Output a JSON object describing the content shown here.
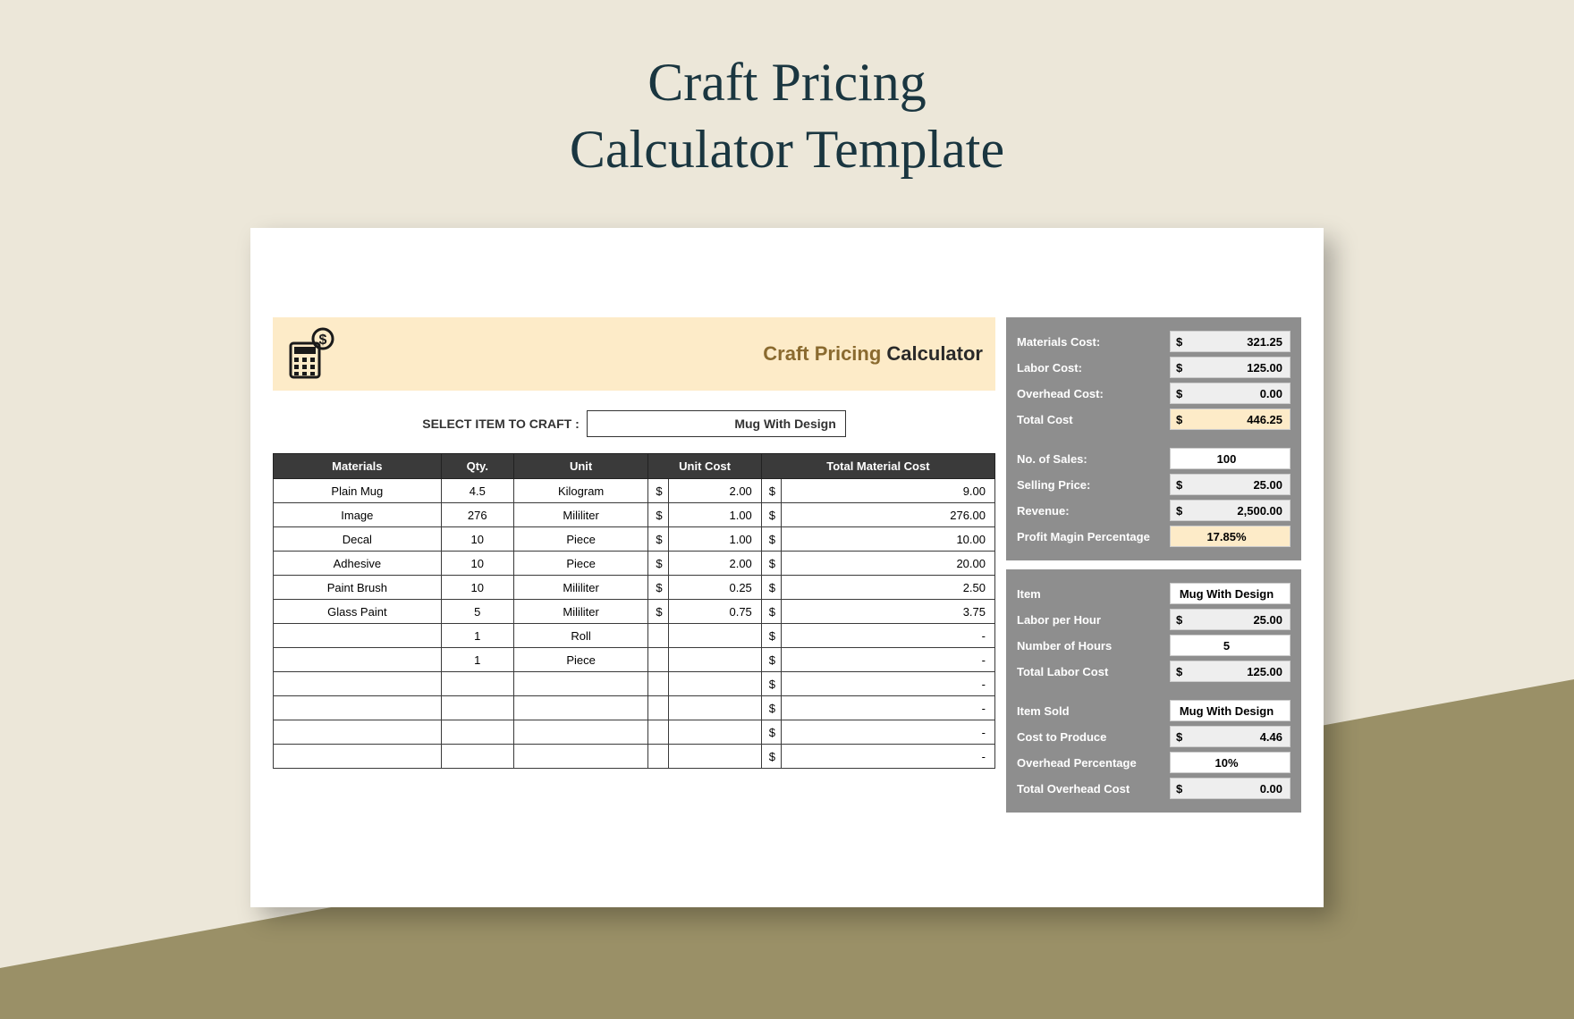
{
  "title_l1": "Craft Pricing",
  "title_l2": "Calculator Template",
  "banner": {
    "a": "Craft Pricing ",
    "b": "Calculator"
  },
  "select": {
    "label": "SELECT ITEM TO CRAFT    :",
    "value": "Mug With Design"
  },
  "cols": {
    "c0": "Materials",
    "c1": "Qty.",
    "c2": "Unit",
    "c3": "Unit Cost",
    "c4": "Total Material Cost"
  },
  "rows": [
    {
      "m": "Plain Mug",
      "q": "4.5",
      "u": "Kilogram",
      "uc": "2.00",
      "t": "9.00"
    },
    {
      "m": "Image",
      "q": "276",
      "u": "Mililiter",
      "uc": "1.00",
      "t": "276.00"
    },
    {
      "m": "Decal",
      "q": "10",
      "u": "Piece",
      "uc": "1.00",
      "t": "10.00"
    },
    {
      "m": "Adhesive",
      "q": "10",
      "u": "Piece",
      "uc": "2.00",
      "t": "20.00"
    },
    {
      "m": "Paint Brush",
      "q": "10",
      "u": "Mililiter",
      "uc": "0.25",
      "t": "2.50"
    },
    {
      "m": "Glass Paint",
      "q": "5",
      "u": "Mililiter",
      "uc": "0.75",
      "t": "3.75"
    },
    {
      "m": "",
      "q": "1",
      "u": "Roll",
      "uc": "",
      "t": "-"
    },
    {
      "m": "",
      "q": "1",
      "u": "Piece",
      "uc": "",
      "t": "-"
    },
    {
      "m": "",
      "q": "",
      "u": "",
      "uc": "",
      "t": "-"
    },
    {
      "m": "",
      "q": "",
      "u": "",
      "uc": "",
      "t": "-"
    },
    {
      "m": "",
      "q": "",
      "u": "",
      "uc": "",
      "t": "-"
    },
    {
      "m": "",
      "q": "",
      "u": "",
      "uc": "",
      "t": "-"
    }
  ],
  "summary": {
    "mat_l": "Materials Cost:",
    "mat_v": "321.25",
    "lab_l": "Labor Cost:",
    "lab_v": "125.00",
    "ovh_l": "Overhead Cost:",
    "ovh_v": "0.00",
    "tot_l": "Total Cost",
    "tot_v": "446.25",
    "sales_l": "No. of Sales:",
    "sales_v": "100",
    "sp_l": "Selling Price:",
    "sp_v": "25.00",
    "rev_l": "Revenue:",
    "rev_v": "2,500.00",
    "pm_l": "Profit Magin Percentage",
    "pm_v": "17.85%"
  },
  "labor": {
    "item_l": "Item",
    "item_v": "Mug With Design",
    "lph_l": "Labor per Hour",
    "lph_v": "25.00",
    "nh_l": "Number of Hours",
    "nh_v": "5",
    "tlc_l": "Total Labor Cost",
    "tlc_v": "125.00"
  },
  "overhead": {
    "is_l": "Item Sold",
    "is_v": "Mug With Design",
    "cp_l": "Cost to Produce",
    "cp_v": "4.46",
    "op_l": "Overhead Percentage",
    "op_v": "10%",
    "toc_l": "Total Overhead Cost",
    "toc_v": "0.00"
  },
  "dollar": "$"
}
